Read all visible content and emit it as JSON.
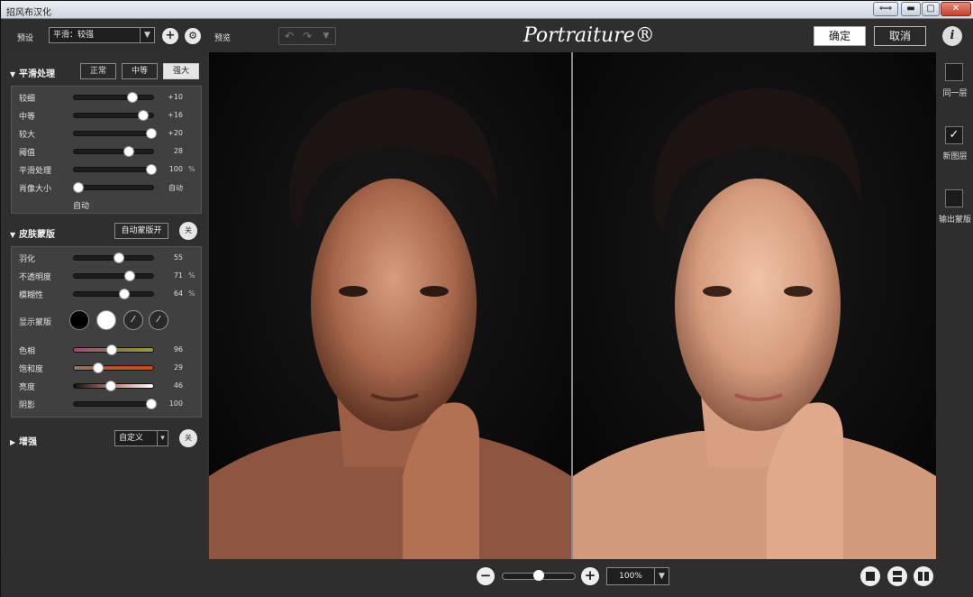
{
  "window": {
    "title": "招风布汉化",
    "btn_resize": "⟺",
    "btn_min": "▬",
    "btn_max": "▢",
    "btn_close": "✕"
  },
  "toolbar": {
    "preset_label": "预设",
    "preset_value": "平滑：较强",
    "add_label": "+",
    "settings_label": "⚙",
    "preview_label": "预览",
    "brand": "Portraiture® 3",
    "ok_label": "确定",
    "cancel_label": "取消",
    "info_label": "i"
  },
  "smoothing": {
    "title": "平滑处理",
    "modes": [
      "正常",
      "中等",
      "强大"
    ],
    "active_mode": "强大",
    "rows": [
      {
        "label": "较细",
        "value": "+10",
        "unit": "",
        "position": 0.72
      },
      {
        "label": "中等",
        "value": "+16",
        "unit": "",
        "position": 0.85
      },
      {
        "label": "较大",
        "value": "+20",
        "unit": "",
        "position": 0.96
      },
      {
        "label": "阈值",
        "value": "28",
        "unit": "",
        "position": 0.68
      },
      {
        "label": "平滑处理",
        "value": "100",
        "unit": "%",
        "position": 0.96
      },
      {
        "label": "肖像大小",
        "value": "自动",
        "unit": "",
        "position": 0.05
      }
    ],
    "auto_note": "自动"
  },
  "skin_mask": {
    "title": "皮肤蒙版",
    "auto_btn": "自动蒙版开",
    "off_btn": "关",
    "rows": [
      {
        "label": "羽化",
        "value": "55",
        "unit": "",
        "position": 0.55
      },
      {
        "label": "不透明度",
        "value": "71",
        "unit": "%",
        "position": 0.69
      },
      {
        "label": "模糊性",
        "value": "64",
        "unit": "%",
        "position": 0.62
      }
    ],
    "show_mask_label": "显示蒙版",
    "color_rows": [
      {
        "label": "色相",
        "value": "96",
        "position": 0.47
      },
      {
        "label": "饱和度",
        "value": "29",
        "position": 0.3
      },
      {
        "label": "亮度",
        "value": "46",
        "position": 0.46
      },
      {
        "label": "阴影",
        "value": "100",
        "position": 0.96
      }
    ]
  },
  "enhance": {
    "title": "增强",
    "preset": "自定义",
    "off_btn": "关"
  },
  "right_panel": {
    "items": [
      {
        "label": "同一层",
        "checked": false
      },
      {
        "label": "新图层",
        "checked": true
      },
      {
        "label": "输出蒙版",
        "checked": false
      }
    ]
  },
  "statusbar": {
    "zoom_value": "100%",
    "zoom_out": "−",
    "zoom_in": "+",
    "zoom_level": 0.5
  },
  "colors": {
    "accent": "#e5e5e5",
    "panel": "#404040"
  }
}
